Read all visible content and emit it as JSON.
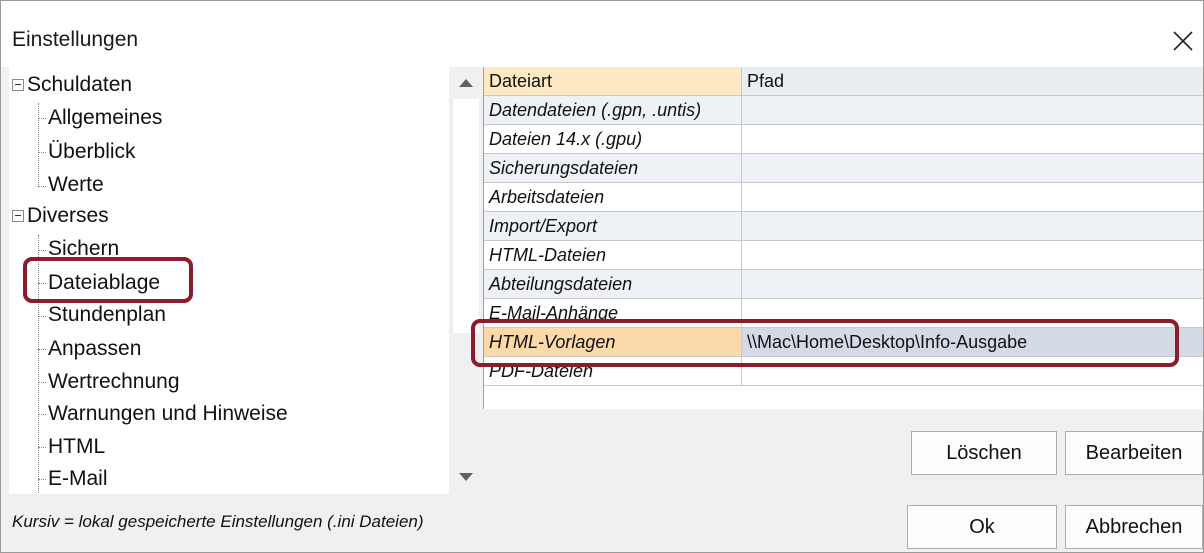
{
  "window": {
    "title": "Einstellungen"
  },
  "tree": {
    "groups": [
      {
        "label": "Schuldaten",
        "items": [
          "Allgemeines",
          "Überblick",
          "Werte"
        ]
      },
      {
        "label": "Diverses",
        "items": [
          "Sichern",
          "Dateiablage",
          "Stundenplan",
          "Anpassen",
          "Wertrechnung",
          "Warnungen und Hinweise",
          "HTML",
          "E-Mail"
        ]
      }
    ],
    "selected": "Dateiablage"
  },
  "grid": {
    "headers": [
      "Dateiart",
      "Pfad"
    ],
    "rows": [
      {
        "type": "Datendateien (.gpn, .untis)",
        "path": ""
      },
      {
        "type": "Dateien 14.x (.gpu)",
        "path": ""
      },
      {
        "type": "Sicherungsdateien",
        "path": ""
      },
      {
        "type": "Arbeitsdateien",
        "path": ""
      },
      {
        "type": "Import/Export",
        "path": ""
      },
      {
        "type": "HTML-Dateien",
        "path": ""
      },
      {
        "type": "Abteilungsdateien",
        "path": ""
      },
      {
        "type": "E-Mail-Anhänge",
        "path": ""
      },
      {
        "type": "HTML-Vorlagen",
        "path": "\\\\Mac\\Home\\Desktop\\Info-Ausgabe"
      },
      {
        "type": "PDF-Dateien",
        "path": ""
      }
    ],
    "selected_row": "HTML-Vorlagen"
  },
  "buttons": {
    "delete": "Löschen",
    "edit": "Bearbeiten",
    "ok": "Ok",
    "cancel": "Abbrechen"
  },
  "footer": {
    "note": "Kursiv = lokal gespeicherte Einstellungen (.ini Dateien)"
  },
  "colors": {
    "highlight": "#8b1c2a",
    "header": "#fde9c3",
    "selected_row": "#d3dae6"
  },
  "icons": [
    "close-icon",
    "collapse-icon",
    "scroll-up-icon",
    "scroll-down-icon"
  ]
}
